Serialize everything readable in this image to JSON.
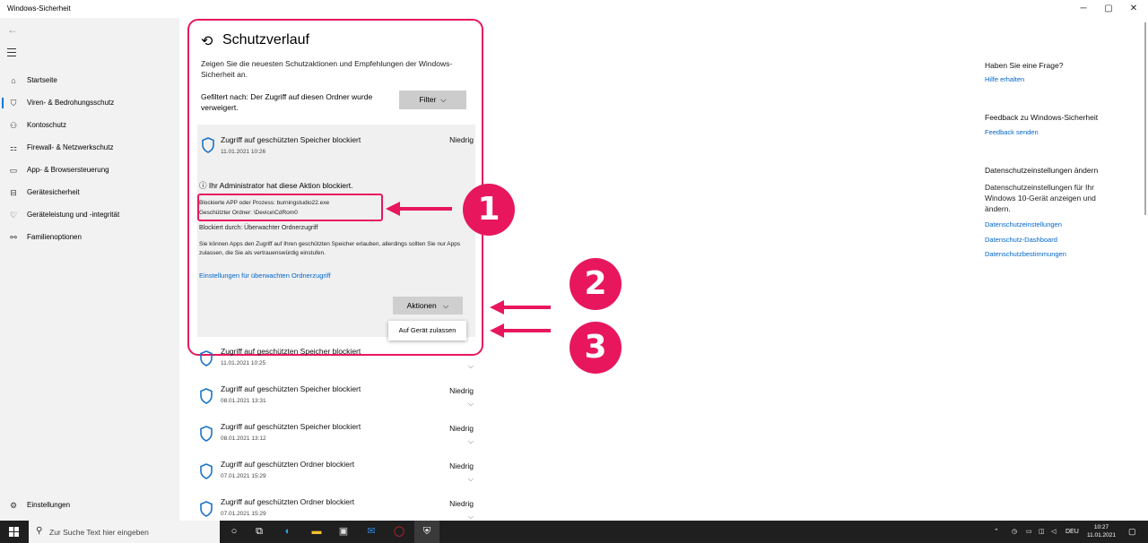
{
  "window": {
    "title": "Windows-Sicherheit",
    "minimize": "─",
    "maximize": "▢",
    "close": "✕"
  },
  "sidebar": {
    "items": [
      {
        "label": "Startseite",
        "icon": "⌂"
      },
      {
        "label": "Viren- & Bedrohungsschutz",
        "icon": "⛉"
      },
      {
        "label": "Kontoschutz",
        "icon": "⚇"
      },
      {
        "label": "Firewall- & Netzwerkschutz",
        "icon": "⚏"
      },
      {
        "label": "App- & Browsersteuerung",
        "icon": "▭"
      },
      {
        "label": "Gerätesicherheit",
        "icon": "⊟"
      },
      {
        "label": "Geräteleistung und -integrität",
        "icon": "♡"
      },
      {
        "label": "Familienoptionen",
        "icon": "⚯"
      }
    ],
    "settings": {
      "label": "Einstellungen",
      "icon": "⚙"
    }
  },
  "page": {
    "title": "Schutzverlauf",
    "description": "Zeigen Sie die neuesten Schutzaktionen und Empfehlungen der Windows-Sicherheit an.",
    "filter_text": "Gefiltert nach: Der Zugriff auf diesen Ordner wurde verweigert.",
    "filter_button": "Filter"
  },
  "expanded_event": {
    "title": "Zugriff auf geschützten Speicher blockiert",
    "date": "11.01.2021 10:26",
    "severity": "Niedrig",
    "admin_note": "Ihr Administrator hat diese Aktion blockiert.",
    "app_line": "Blockierte APP oder Prozess: burningstudio22.exe",
    "folder_line": "Geschützter Ordner: \\Device\\CdRom0",
    "blocked_by": "Blockiert durch: Überwachter Ordnerzugriff",
    "info": "Sie können Apps den Zugriff auf Ihren geschützten Speicher erlauben, allerdings sollten Sie nur Apps zulassen, die Sie als vertrauenswürdig einstufen.",
    "settings_link": "Einstellungen für überwachten Ordnerzugriff",
    "actions_button": "Aktionen",
    "dropdown_item": "Auf Gerät zulassen"
  },
  "events": [
    {
      "title": "Zugriff auf geschützten Speicher blockiert",
      "date": "11.01.2021 10:25",
      "severity": ""
    },
    {
      "title": "Zugriff auf geschützten Speicher blockiert",
      "date": "08.01.2021 13:31",
      "severity": "Niedrig"
    },
    {
      "title": "Zugriff auf geschützten Speicher blockiert",
      "date": "08.01.2021 13:12",
      "severity": "Niedrig"
    },
    {
      "title": "Zugriff auf geschützten Ordner blockiert",
      "date": "07.01.2021 15:29",
      "severity": "Niedrig"
    },
    {
      "title": "Zugriff auf geschützten Ordner blockiert",
      "date": "07.01.2021 15:29",
      "severity": "Niedrig"
    }
  ],
  "right": {
    "q_heading": "Haben Sie eine Frage?",
    "q_link": "Hilfe erhalten",
    "fb_heading": "Feedback zu Windows-Sicherheit",
    "fb_link": "Feedback senden",
    "priv_heading": "Datenschutzeinstellungen ändern",
    "priv_text": "Datenschutzeinstellungen für Ihr Windows 10-Gerät anzeigen und ändern.",
    "priv_links": [
      "Datenschutzeinstellungen",
      "Datenschutz-Dashboard",
      "Datenschutzbestimmungen"
    ]
  },
  "annotations": {
    "badges": [
      "1",
      "2",
      "3"
    ]
  },
  "colors": {
    "accent": "#e8175d",
    "link": "#0066cc",
    "shield": "#1a73c8"
  },
  "taskbar": {
    "search_placeholder": "Zur Suche Text hier eingeben",
    "language": "DEU",
    "time": "10:27",
    "date": "11.01.2021"
  }
}
